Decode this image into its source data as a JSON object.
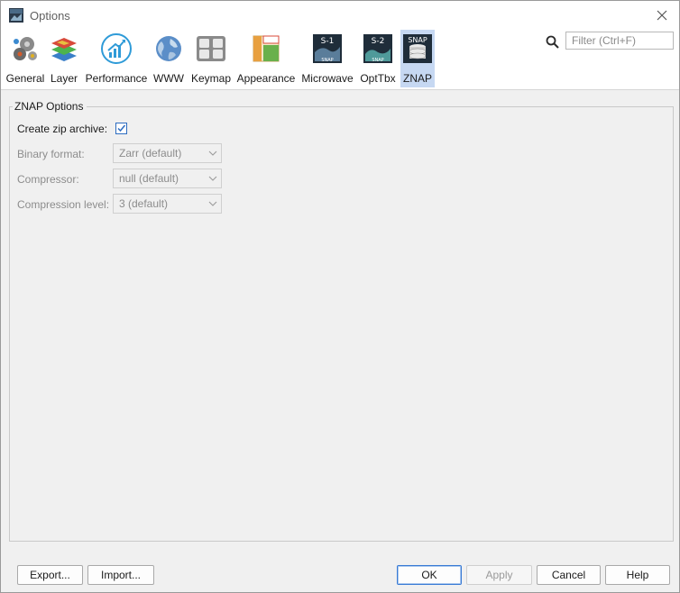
{
  "window": {
    "title": "Options",
    "close_icon": "close-icon"
  },
  "categories": [
    {
      "label": "General",
      "icon": "gears-icon"
    },
    {
      "label": "Layer",
      "icon": "layers-icon"
    },
    {
      "label": "Performance",
      "icon": "performance-icon"
    },
    {
      "label": "WWW",
      "icon": "globe-icon"
    },
    {
      "label": "Keymap",
      "icon": "keymap-icon"
    },
    {
      "label": "Appearance",
      "icon": "appearance-icon"
    },
    {
      "label": "Microwave",
      "icon": "s1-toolbox-icon",
      "badge_top": "S-1",
      "badge_bottom": "SNAP"
    },
    {
      "label": "OptTbx",
      "icon": "s2-toolbox-icon",
      "badge_top": "S-2",
      "badge_bottom": "SNAP"
    },
    {
      "label": "ZNAP",
      "icon": "znap-icon",
      "badge_top": "SNAP",
      "selected": true
    }
  ],
  "search": {
    "placeholder": "Filter (Ctrl+F)",
    "value": ""
  },
  "panel": {
    "title": "ZNAP Options",
    "create_zip": {
      "label": "Create zip archive:",
      "checked": true
    },
    "binary_format": {
      "label": "Binary format:",
      "value": "Zarr (default)"
    },
    "compressor": {
      "label": "Compressor:",
      "value": "null (default)"
    },
    "compression_level": {
      "label": "Compression level:",
      "value": "3 (default)"
    }
  },
  "buttons": {
    "export": "Export...",
    "import": "Import...",
    "ok": "OK",
    "apply": "Apply",
    "cancel": "Cancel",
    "help": "Help"
  },
  "colors": {
    "accent": "#2d6cc0",
    "selected_bg": "#c6d8f2"
  }
}
